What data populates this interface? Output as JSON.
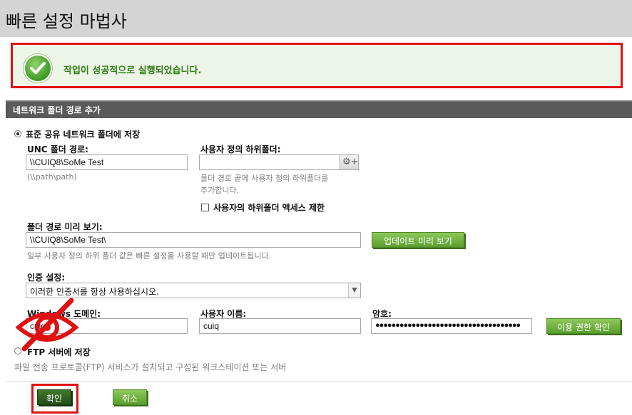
{
  "window": {
    "title": "빠른 설정 마법사"
  },
  "banner": {
    "message": "작업이 성공적으로 실행되었습니다."
  },
  "section": {
    "title": "네트워크 폴더 경로 추가"
  },
  "options": {
    "standard_share": {
      "label": "표준 공유 네트워크 폴더에 저장",
      "selected": true
    },
    "ftp": {
      "label": "FTP 서버에 저장",
      "selected": false,
      "description": "파일 전송 프로토콜(FTP) 서비스가 설치되고 구성된 워크스테이션 또는 서버"
    }
  },
  "unc": {
    "label": "UNC 폴더 경로:",
    "value": "\\\\CUIQ8\\SoMe Test",
    "hint": "(\\\\path\\path)"
  },
  "subfolder": {
    "label": "사용자 정의 하위폴더:",
    "value": "",
    "hint_line1": "폴더 경로 끝에 사용자 정의 하위폴더를",
    "hint_line2": "추가합니다.",
    "restrict_label": "사용자의 하위폴더 액세스 제한",
    "restrict_checked": false
  },
  "preview": {
    "label": "폴더 경로 미리 보기:",
    "value": "\\\\CUIQ8\\SoMe Test\\",
    "button": "업데이트 미리 보기",
    "hint": "일부 사용자 정의 하위 폴더 값은 빠른 설정을 사용할 때만 업데이트됩니다."
  },
  "auth": {
    "label": "인증 설정:",
    "selected": "이러한 인증서를 항상 사용하십시오."
  },
  "domain": {
    "label": "Windows 도메인:",
    "value": "cuiq"
  },
  "username": {
    "label": "사용자 이름:",
    "value": "cuiq"
  },
  "password": {
    "label": "암호:",
    "value": "●●●●●●●●●●●●●●●●●●●●●●●●●●●●●●●●●●●●",
    "verify_button": "이용 권한 확인"
  },
  "footer": {
    "ok": "확인",
    "cancel": "취소"
  },
  "colors": {
    "accent_green": "#5b9e2e",
    "highlight_red": "#e01010",
    "header_gray": "#5a5a5a"
  },
  "icons": [
    "check-circle-icon",
    "gear-plus-icon",
    "eye-slash-icon",
    "chevron-down-icon"
  ]
}
